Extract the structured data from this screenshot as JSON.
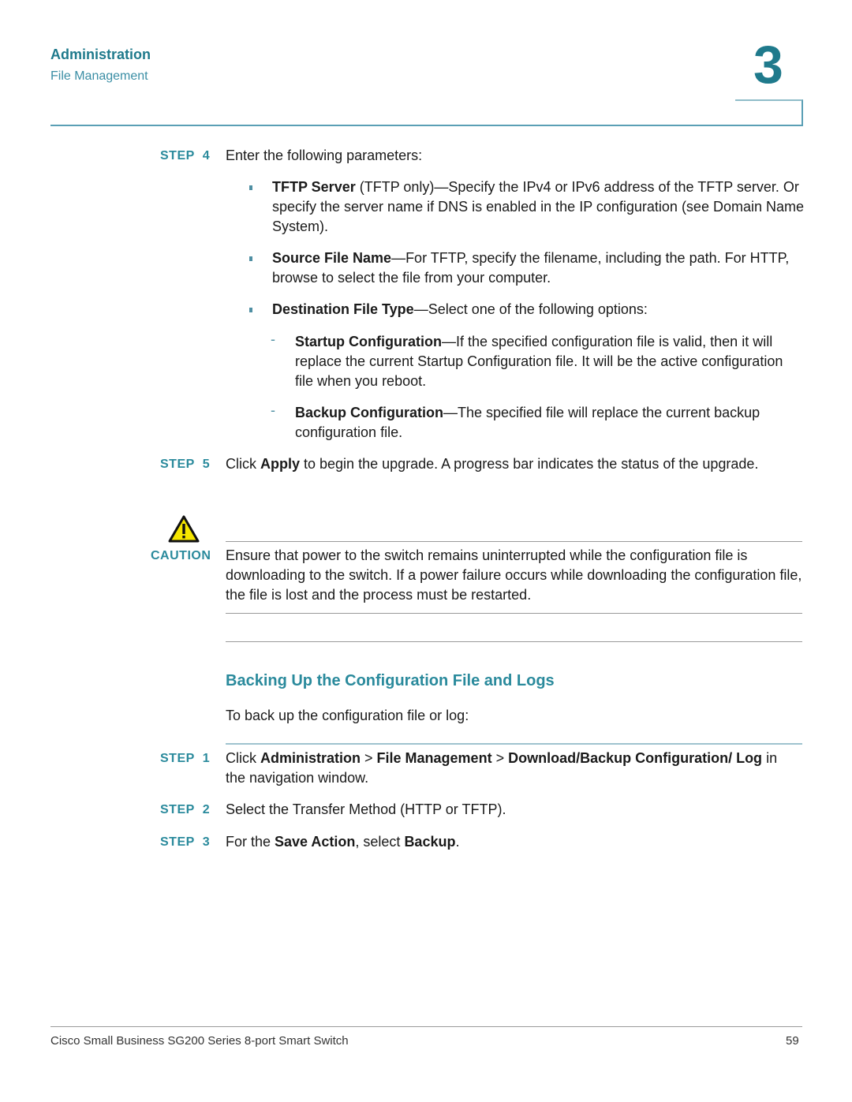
{
  "header": {
    "chapter_title": "Administration",
    "section_title": "File Management",
    "chapter_number": "3"
  },
  "steps_download": [
    {
      "label": "STEP",
      "number": "4",
      "text": "Enter the following parameters:"
    },
    {
      "label": "STEP",
      "number": "5",
      "text_before": "Click ",
      "bold": "Apply",
      "text_after": " to begin the upgrade. A progress bar indicates the status of the upgrade."
    }
  ],
  "parameters": [
    {
      "bold": "TFTP Server",
      "text": " (TFTP only)—Specify the IPv4 or IPv6 address of the TFTP server. Or specify the server name if DNS is enabled in the IP configuration (see Domain Name System)."
    },
    {
      "bold": "Source File Name",
      "text": "—For TFTP, specify the filename, including the path. For HTTP, browse to select the file from your computer."
    },
    {
      "bold": "Destination File Type",
      "text": "—Select one of the following options:"
    }
  ],
  "file_type_options": [
    {
      "bold": "Startup Configuration",
      "text": "—If the specified configuration file is valid, then it will replace the current Startup Configuration file. It will be the active configuration file when you reboot."
    },
    {
      "bold": "Backup Configuration",
      "text": "—The specified file will replace the current backup configuration file."
    }
  ],
  "caution": {
    "label": "CAUTION",
    "icon": "warning-triangle-icon",
    "text": "Ensure that power to the switch remains uninterrupted while the configuration file is downloading to the switch. If a power failure occurs while downloading the configuration file, the file is lost and the process must be restarted."
  },
  "backup_section": {
    "heading": "Backing Up the Configuration File and Logs",
    "intro": "To back up the configuration file or log:",
    "steps": [
      {
        "label": "STEP",
        "number": "1",
        "parts": [
          "Click ",
          "Administration",
          " > ",
          "File Management",
          " > ",
          "Download/Backup Configuration/ Log",
          " in the navigation window."
        ]
      },
      {
        "label": "STEP",
        "number": "2",
        "text": "Select the Transfer Method (HTTP or TFTP)."
      },
      {
        "label": "STEP",
        "number": "3",
        "parts": [
          "For the ",
          "Save Action",
          ", select ",
          "Backup",
          "."
        ]
      }
    ]
  },
  "footer": {
    "product": "Cisco Small Business SG200 Series 8-port Smart Switch",
    "page_number": "59"
  },
  "colors": {
    "accent": "#1f7a8c",
    "step_label": "#2a8a9c",
    "warning_yellow": "#f5e600"
  }
}
